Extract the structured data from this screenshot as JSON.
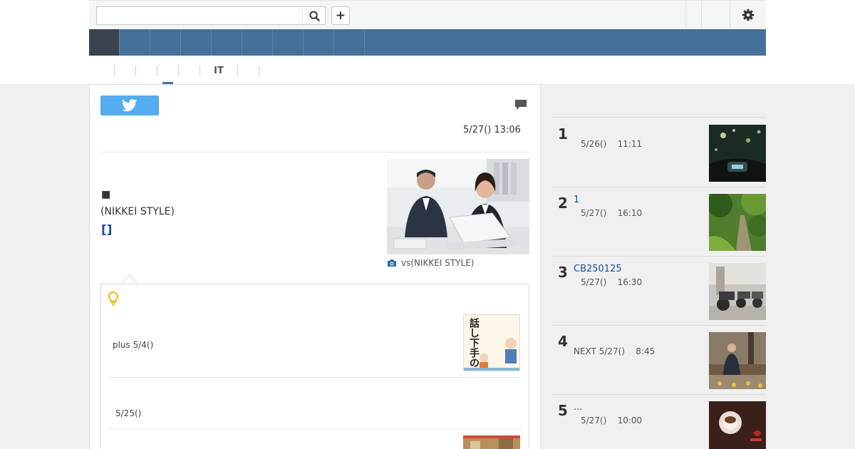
{
  "header": {
    "search": {
      "placeholder": "",
      "value": ""
    },
    "plus_label": "+"
  },
  "navbar": {
    "items": [
      "",
      "",
      "",
      "",
      "",
      "",
      "",
      "",
      ""
    ]
  },
  "subnav": {
    "items": [
      "",
      "",
      "",
      "",
      "",
      "IT",
      "",
      ""
    ],
    "active_index": 2
  },
  "article": {
    "timestamp": "5/27() 13:06",
    "bullet": "■",
    "source": "(NIKKEI STYLE)",
    "author_link": "[]",
    "photo_caption": "vs(NIKKEI STYLE)"
  },
  "related": {
    "items": [
      {
        "text": "plus 5/4()"
      },
      {
        "text": "5/25()"
      }
    ],
    "book_cover_text": "話し下手のための雑談力"
  },
  "ranking": {
    "items": [
      {
        "num": "1",
        "title": "",
        "date": "5/26()",
        "time": "11:11"
      },
      {
        "num": "2",
        "title": "1",
        "date": "5/27()",
        "time": "16:10"
      },
      {
        "num": "3",
        "title": "CB250125",
        "date": "5/27()",
        "time": "16:30"
      },
      {
        "num": "4",
        "title": "",
        "date": "NEXT   5/27()",
        "time": "8:45"
      },
      {
        "num": "5",
        "title": "...",
        "date": "5/27()",
        "time": "10:00"
      }
    ]
  },
  "colors": {
    "nav_blue": "#44709a",
    "nav_active": "#3b4350",
    "twitter_blue": "#55acee",
    "link_blue": "#1b4e9b",
    "bulb_yellow": "#f0b400"
  },
  "icons": [
    "search-icon",
    "plus-icon",
    "gear-icon",
    "twitter-icon",
    "comment-icon",
    "camera-icon",
    "lightbulb-icon"
  ]
}
